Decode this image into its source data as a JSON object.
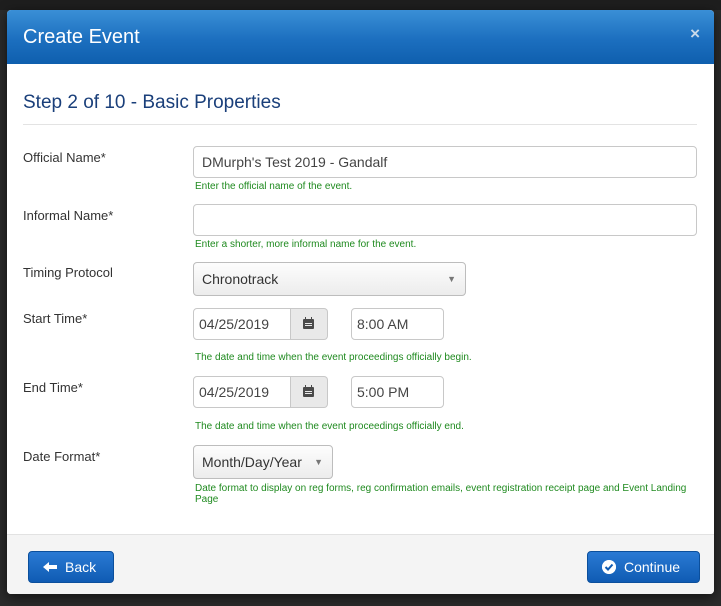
{
  "modal": {
    "title": "Create Event",
    "close_symbol": "×",
    "step_title": "Step 2 of 10 - Basic Properties"
  },
  "fields": {
    "official_name": {
      "label": "Official Name*",
      "value": "DMurph's Test 2019 - Gandalf",
      "help": "Enter the official name of the event."
    },
    "informal_name": {
      "label": "Informal Name*",
      "value": "",
      "help": "Enter a shorter, more informal name for the event."
    },
    "timing_protocol": {
      "label": "Timing Protocol",
      "selected": "Chronotrack"
    },
    "start_time": {
      "label": "Start Time*",
      "date": "04/25/2019",
      "time": "8:00 AM",
      "help": "The date and time when the event proceedings officially begin."
    },
    "end_time": {
      "label": "End Time*",
      "date": "04/25/2019",
      "time": "5:00 PM",
      "help": "The date and time when the event proceedings officially end."
    },
    "date_format": {
      "label": "Date Format*",
      "selected": "Month/Day/Year",
      "help": "Date format to display on reg forms, reg confirmation emails, event registration receipt page and Event Landing Page"
    }
  },
  "footer": {
    "back_label": "Back",
    "continue_label": "Continue"
  },
  "icons": {
    "close": "close-icon",
    "calendar": "calendar-icon",
    "back": "arrow-left-icon",
    "continue": "check-circle-icon",
    "dropdown": "caret-down-icon"
  },
  "colors": {
    "header_blue": "#1c6fbf",
    "title_text": "#1a3f7a",
    "help_text": "#1f8a1f",
    "button_blue": "#0f5bb3"
  }
}
